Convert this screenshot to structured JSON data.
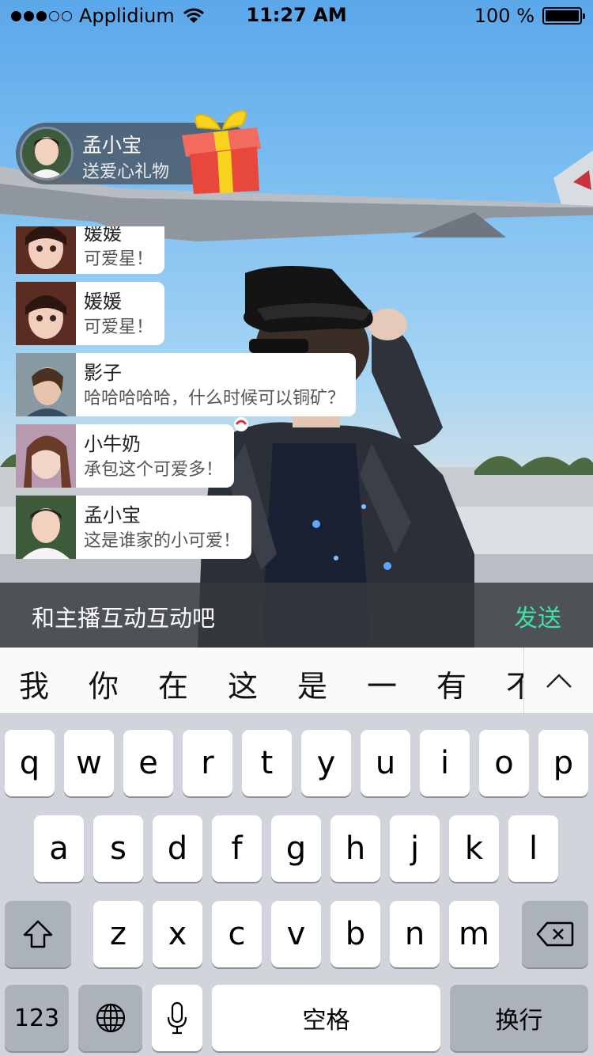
{
  "status_bar": {
    "carrier": "Applidium",
    "time": "11:27 AM",
    "battery": "100 %"
  },
  "gift_banner": {
    "name": "孟小宝",
    "message": "送爱心礼物"
  },
  "comments": [
    {
      "name": "媛媛",
      "message": "可爱星！"
    },
    {
      "name": "媛媛",
      "message": "可爱星！"
    },
    {
      "name": "影子",
      "message": "哈哈哈哈哈，什么时候可以铜矿？"
    },
    {
      "name": "小牛奶",
      "message": "承包这个可爱多！"
    },
    {
      "name": "孟小宝",
      "message": "这是谁家的小可爱！"
    }
  ],
  "input_bar": {
    "placeholder": "和主播互动互动吧",
    "send_label": "发送"
  },
  "candidates": [
    "我",
    "你",
    "在",
    "这",
    "是",
    "一",
    "有",
    "不"
  ],
  "keyboard": {
    "row1": [
      "q",
      "w",
      "e",
      "r",
      "t",
      "y",
      "u",
      "i",
      "o",
      "p"
    ],
    "row2": [
      "a",
      "s",
      "d",
      "f",
      "g",
      "h",
      "j",
      "k",
      "l"
    ],
    "row3": [
      "z",
      "x",
      "c",
      "v",
      "b",
      "n",
      "m"
    ],
    "numbers_label": "123",
    "space_label": "空格",
    "return_label": "换行"
  },
  "colors": {
    "send_accent": "#3fe0a4",
    "gift_red": "#e8473c",
    "gift_ribbon": "#f7d31e"
  }
}
